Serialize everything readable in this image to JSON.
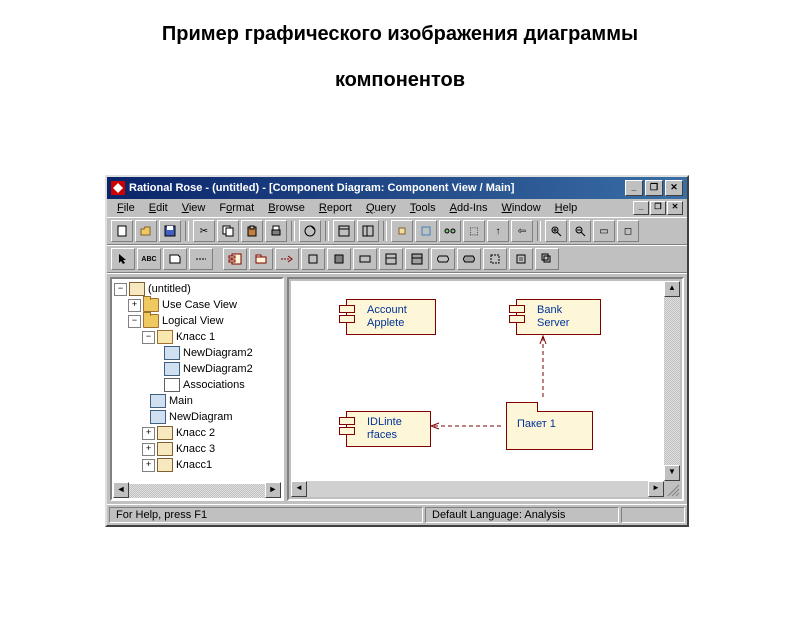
{
  "slide": {
    "title_line1": "Пример графического изображения диаграммы",
    "title_line2": "компонентов"
  },
  "window": {
    "title": "Rational Rose - (untitled) - [Component Diagram: Component View / Main]"
  },
  "menu": {
    "file": "File",
    "edit": "Edit",
    "view": "View",
    "format": "Format",
    "browse": "Browse",
    "report": "Report",
    "query": "Query",
    "tools": "Tools",
    "addins": "Add-Ins",
    "window": "Window",
    "help": "Help"
  },
  "toolbox": {
    "abc": "ABC"
  },
  "tree": {
    "root": "(untitled)",
    "use_case_view": "Use Case View",
    "logical_view": "Logical View",
    "class1": "Класс 1",
    "newdiag1": "NewDiagram2",
    "newdiag2": "NewDiagram2",
    "associations": "Associations",
    "main": "Main",
    "newdiagram": "NewDiagram",
    "class2": "Класс 2",
    "class3": "Класс 3",
    "class1b": "Класс1"
  },
  "diagram": {
    "account_applete": "Account\nApplete",
    "bank_server": "Bank\nServer",
    "idl_interfaces": "IDLinte\nrfaces",
    "paket1": "Пакет 1"
  },
  "status": {
    "help": "For Help, press F1",
    "lang": "Default Language: Analysis"
  }
}
